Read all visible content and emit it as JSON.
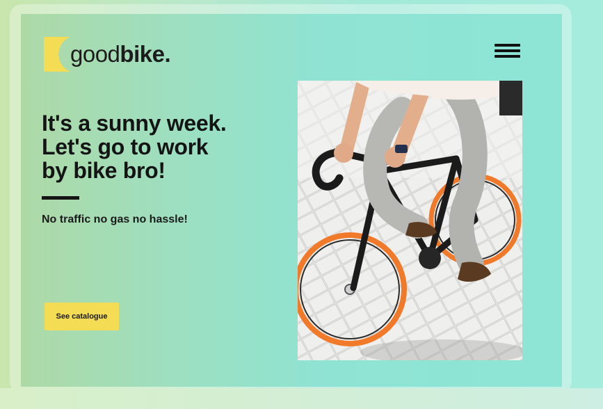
{
  "brand": {
    "name_light": "good",
    "name_bold": "bike."
  },
  "header": {
    "menu_icon": "hamburger-menu-icon"
  },
  "hero": {
    "headline_lines": [
      "It's a sunny week.",
      "Let's go to work",
      "by bike bro!"
    ],
    "subtitle": "No traffic no gas no hassle!",
    "cta_label": "See catalogue"
  },
  "colors": {
    "accent_yellow": "#f4dd55",
    "teal_background": "#8ee5d6",
    "tire_orange": "#f07a2a",
    "text_dark": "#141414"
  }
}
